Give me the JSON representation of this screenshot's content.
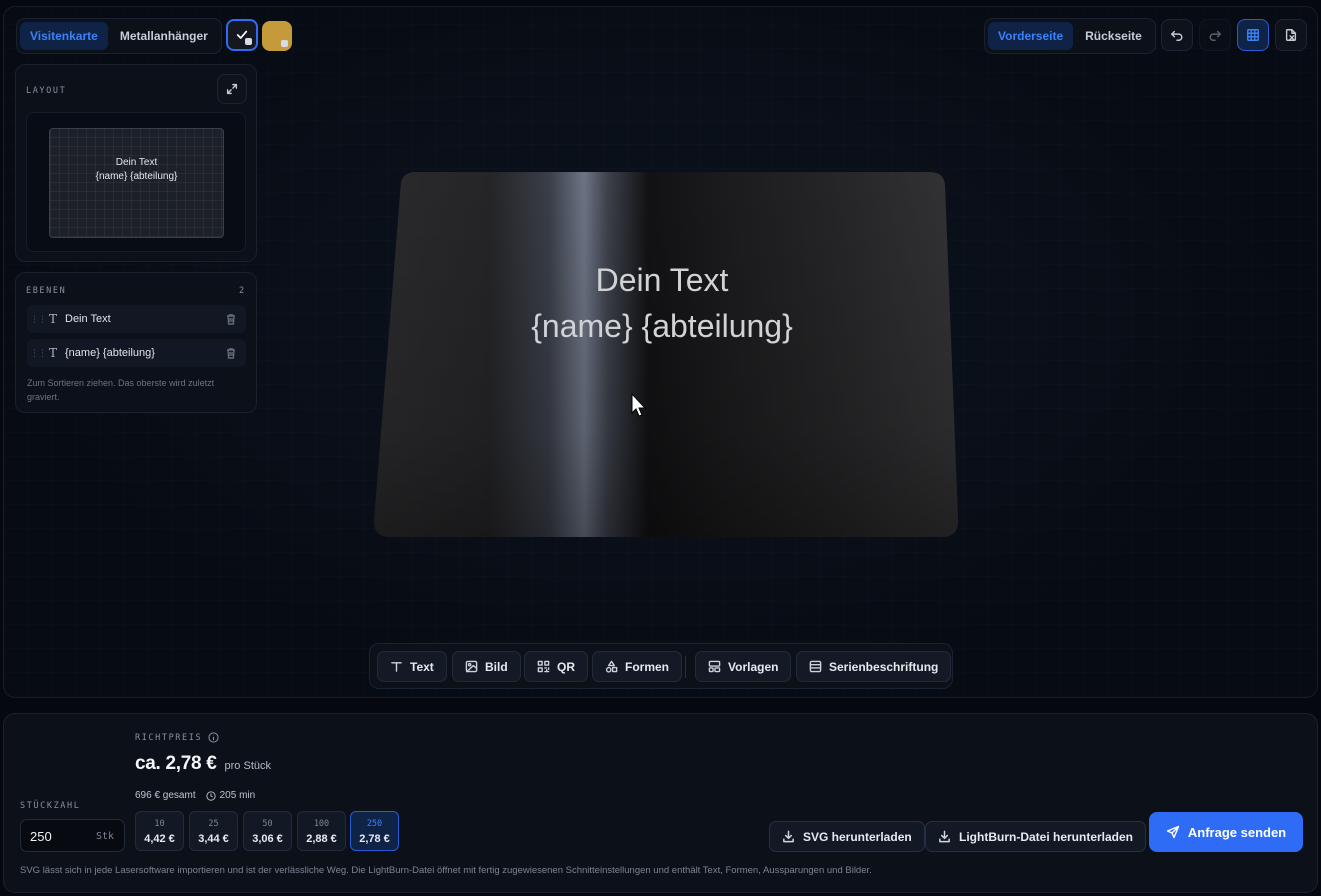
{
  "product_tabs": [
    {
      "label": "Visitenkarte",
      "active": true
    },
    {
      "label": "Metallanhänger",
      "active": false
    }
  ],
  "material_swatches": [
    {
      "name": "schwarz",
      "color": "#15181f",
      "selected": true
    },
    {
      "name": "gold",
      "color": "#c49a3a",
      "selected": false
    }
  ],
  "side_tabs": [
    {
      "label": "Vorderseite",
      "active": true
    },
    {
      "label": "Rückseite",
      "active": false
    }
  ],
  "top_icons": [
    "undo-icon",
    "redo-icon",
    "grid-icon",
    "export-file-icon"
  ],
  "layout_panel": {
    "title": "LAYOUT",
    "preview_line1": "Dein Text",
    "preview_line2": "{name} {abteilung}"
  },
  "layers_panel": {
    "title": "EBENEN",
    "count": "2",
    "items": [
      {
        "label": "Dein Text"
      },
      {
        "label": "{name} {abteilung}"
      }
    ],
    "hint": "Zum Sortieren ziehen. Das oberste wird zuletzt graviert."
  },
  "card": {
    "line1": "Dein Text",
    "line2": "{name} {abteilung}"
  },
  "toolbar": {
    "text": "Text",
    "image": "Bild",
    "qr": "QR",
    "shapes": "Formen",
    "templates": "Vorlagen",
    "serial": "Serienbeschriftung"
  },
  "pricing": {
    "label": "RICHTPREIS",
    "price": "ca. 2,78 €",
    "unit": "pro Stück",
    "total": "696 € gesamt",
    "time": "205 min",
    "quantity_label": "STÜCKZAHL",
    "quantity_value": "250",
    "quantity_unit": "Stk",
    "tiers": [
      {
        "qty": "10",
        "price": "4,42 €",
        "active": false
      },
      {
        "qty": "25",
        "price": "3,44 €",
        "active": false
      },
      {
        "qty": "50",
        "price": "3,06 €",
        "active": false
      },
      {
        "qty": "100",
        "price": "2,88 €",
        "active": false
      },
      {
        "qty": "250",
        "price": "2,78 €",
        "active": true
      }
    ]
  },
  "actions": {
    "svg_download": "SVG herunterladen",
    "lightburn_download": "LightBurn-Datei herunterladen",
    "send_request": "Anfrage senden"
  },
  "footer_note": "SVG lässt sich in jede Lasersoftware importieren und ist der verlässliche Weg. Die LightBurn-Datei öffnet mit fertig zugewiesenen Schnitteinstellungen und enthält Text, Formen, Aussparungen und Bilder.",
  "colors": {
    "accent": "#2f6cf6",
    "active_tab_bg": "#0f2347",
    "gold": "#c49a3a"
  }
}
